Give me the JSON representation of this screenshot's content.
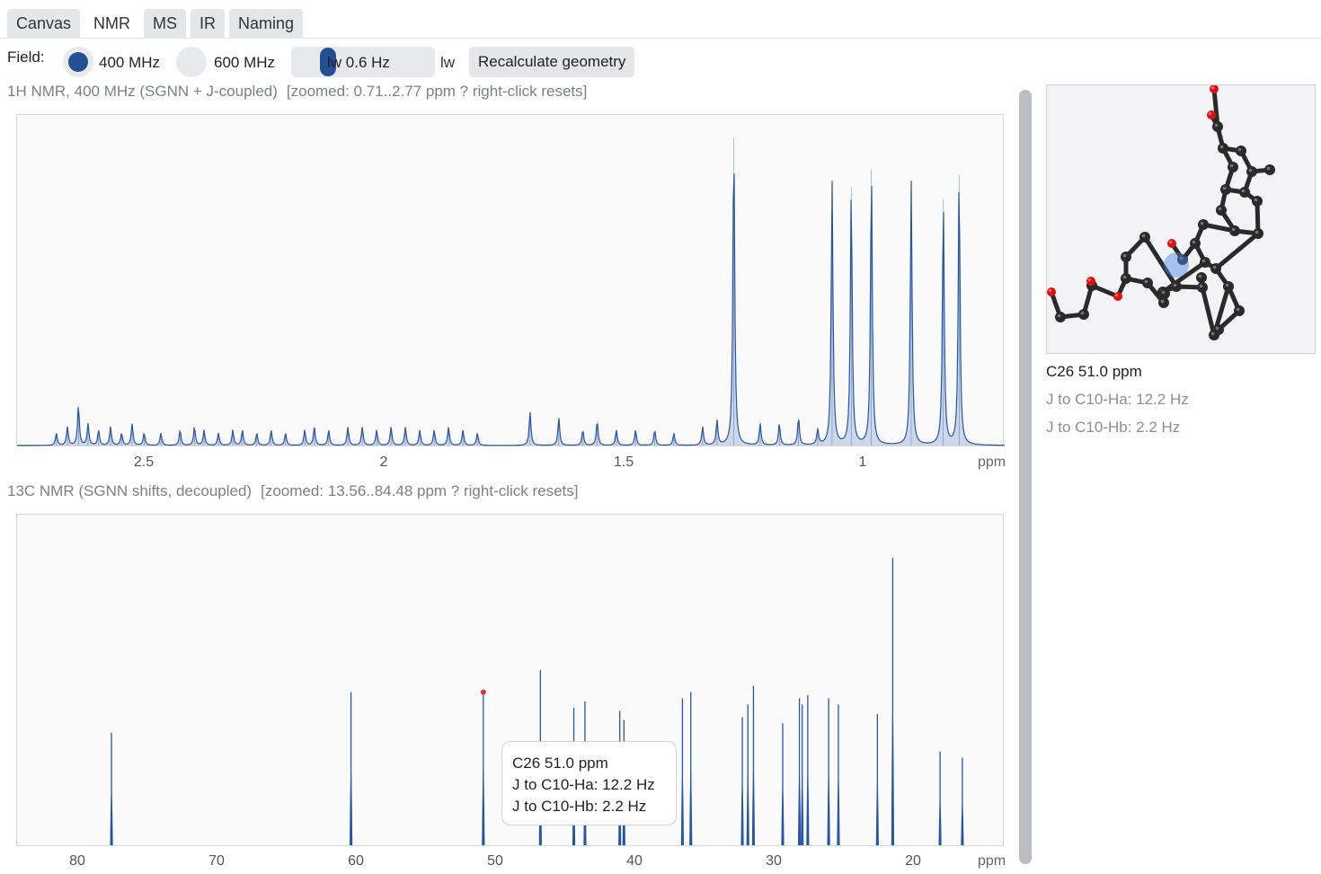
{
  "tabs": [
    {
      "label": "Canvas",
      "active": false
    },
    {
      "label": "NMR",
      "active": true
    },
    {
      "label": "MS",
      "active": false
    },
    {
      "label": "IR",
      "active": false
    },
    {
      "label": "Naming",
      "active": false
    }
  ],
  "field": {
    "label": "Field:",
    "options": [
      {
        "label": "400 MHz",
        "selected": true
      },
      {
        "label": "600 MHz",
        "selected": false
      }
    ],
    "linewidth_text": "lw 0.6 Hz",
    "linewidth_suffix": "lw",
    "recalc_label": "Recalculate geometry"
  },
  "h1": {
    "title": "1H NMR, 400 MHz (SGNN + J-coupled)",
    "zoom_text": "[zoomed: 0.71..2.77 ppm ? right-click resets]",
    "unit_label": "ppm"
  },
  "c13": {
    "title": "13C NMR (SGNN shifts, decoupled)",
    "zoom_text": "[zoomed: 13.56..84.48 ppm ? right-click resets]",
    "unit_label": "ppm"
  },
  "selection": {
    "title": "C26  51.0 ppm",
    "lines": [
      "J to C10-Ha: 12.2 Hz",
      "J to C10-Hb: 2.2 Hz"
    ]
  },
  "colors": {
    "spectrum": "#2756a3",
    "fill": "#b9c8e1",
    "highlight": "#e03030",
    "atom": "#2a2a2a",
    "oxygen": "#e01010",
    "selected_atom": "#4a86e8"
  },
  "chart_data": [
    {
      "type": "line",
      "name": "1H NMR spectrum",
      "xlim": [
        2.77,
        0.71
      ],
      "ylim": [
        0,
        1
      ],
      "xticks": [
        2.5,
        2.0,
        1.5,
        1.0
      ],
      "xlabel": "ppm",
      "grid": false,
      "peaks": [
        {
          "ppm": 2.688,
          "h": 0.04
        },
        {
          "ppm": 2.665,
          "h": 0.06
        },
        {
          "ppm": 2.642,
          "h": 0.13
        },
        {
          "ppm": 2.622,
          "h": 0.07
        },
        {
          "ppm": 2.6,
          "h": 0.05
        },
        {
          "ppm": 2.575,
          "h": 0.06
        },
        {
          "ppm": 2.552,
          "h": 0.04
        },
        {
          "ppm": 2.53,
          "h": 0.07
        },
        {
          "ppm": 2.505,
          "h": 0.04
        },
        {
          "ppm": 2.47,
          "h": 0.04
        },
        {
          "ppm": 2.43,
          "h": 0.05
        },
        {
          "ppm": 2.4,
          "h": 0.06
        },
        {
          "ppm": 2.38,
          "h": 0.05
        },
        {
          "ppm": 2.35,
          "h": 0.04
        },
        {
          "ppm": 2.32,
          "h": 0.05
        },
        {
          "ppm": 2.3,
          "h": 0.05
        },
        {
          "ppm": 2.27,
          "h": 0.04
        },
        {
          "ppm": 2.24,
          "h": 0.05
        },
        {
          "ppm": 2.21,
          "h": 0.04
        },
        {
          "ppm": 2.17,
          "h": 0.05
        },
        {
          "ppm": 2.15,
          "h": 0.06
        },
        {
          "ppm": 2.12,
          "h": 0.05
        },
        {
          "ppm": 2.08,
          "h": 0.06
        },
        {
          "ppm": 2.05,
          "h": 0.06
        },
        {
          "ppm": 2.02,
          "h": 0.05
        },
        {
          "ppm": 1.99,
          "h": 0.06
        },
        {
          "ppm": 1.96,
          "h": 0.06
        },
        {
          "ppm": 1.93,
          "h": 0.05
        },
        {
          "ppm": 1.9,
          "h": 0.05
        },
        {
          "ppm": 1.87,
          "h": 0.06
        },
        {
          "ppm": 1.84,
          "h": 0.05
        },
        {
          "ppm": 1.81,
          "h": 0.04
        },
        {
          "ppm": 1.7,
          "h": 0.11
        },
        {
          "ppm": 1.64,
          "h": 0.09
        },
        {
          "ppm": 1.59,
          "h": 0.05
        },
        {
          "ppm": 1.56,
          "h": 0.08
        },
        {
          "ppm": 1.52,
          "h": 0.05
        },
        {
          "ppm": 1.48,
          "h": 0.05
        },
        {
          "ppm": 1.44,
          "h": 0.05
        },
        {
          "ppm": 1.4,
          "h": 0.04
        },
        {
          "ppm": 1.34,
          "h": 0.06
        },
        {
          "ppm": 1.31,
          "h": 0.08
        },
        {
          "ppm": 1.275,
          "h": 1.0
        },
        {
          "ppm": 1.22,
          "h": 0.07
        },
        {
          "ppm": 1.18,
          "h": 0.07
        },
        {
          "ppm": 1.14,
          "h": 0.09
        },
        {
          "ppm": 1.1,
          "h": 0.05
        },
        {
          "ppm": 1.07,
          "h": 0.86
        },
        {
          "ppm": 1.03,
          "h": 0.84
        },
        {
          "ppm": 0.988,
          "h": 0.9
        },
        {
          "ppm": 0.905,
          "h": 0.86
        },
        {
          "ppm": 0.838,
          "h": 0.8
        },
        {
          "ppm": 0.805,
          "h": 0.88
        }
      ]
    },
    {
      "type": "bar",
      "name": "13C NMR spectrum",
      "xlim": [
        84.48,
        13.56
      ],
      "ylim": [
        0,
        1
      ],
      "xticks": [
        80,
        70,
        60,
        50,
        40,
        30,
        20
      ],
      "xlabel": "ppm",
      "grid": false,
      "highlight_ppm": 51.0,
      "peaks": [
        {
          "ppm": 77.7,
          "h": 0.36
        },
        {
          "ppm": 60.5,
          "h": 0.49
        },
        {
          "ppm": 51.0,
          "h": 0.49
        },
        {
          "ppm": 46.9,
          "h": 0.56
        },
        {
          "ppm": 44.5,
          "h": 0.44
        },
        {
          "ppm": 43.7,
          "h": 0.46
        },
        {
          "ppm": 41.2,
          "h": 0.43
        },
        {
          "ppm": 40.9,
          "h": 0.4
        },
        {
          "ppm": 36.7,
          "h": 0.47
        },
        {
          "ppm": 36.1,
          "h": 0.49
        },
        {
          "ppm": 32.4,
          "h": 0.41
        },
        {
          "ppm": 32.0,
          "h": 0.45
        },
        {
          "ppm": 31.6,
          "h": 0.51
        },
        {
          "ppm": 29.5,
          "h": 0.39
        },
        {
          "ppm": 28.3,
          "h": 0.47
        },
        {
          "ppm": 28.1,
          "h": 0.45
        },
        {
          "ppm": 27.7,
          "h": 0.48
        },
        {
          "ppm": 26.2,
          "h": 0.47
        },
        {
          "ppm": 25.5,
          "h": 0.45
        },
        {
          "ppm": 22.7,
          "h": 0.42
        },
        {
          "ppm": 21.6,
          "h": 0.92
        },
        {
          "ppm": 18.2,
          "h": 0.3
        },
        {
          "ppm": 16.6,
          "h": 0.28
        }
      ]
    }
  ]
}
